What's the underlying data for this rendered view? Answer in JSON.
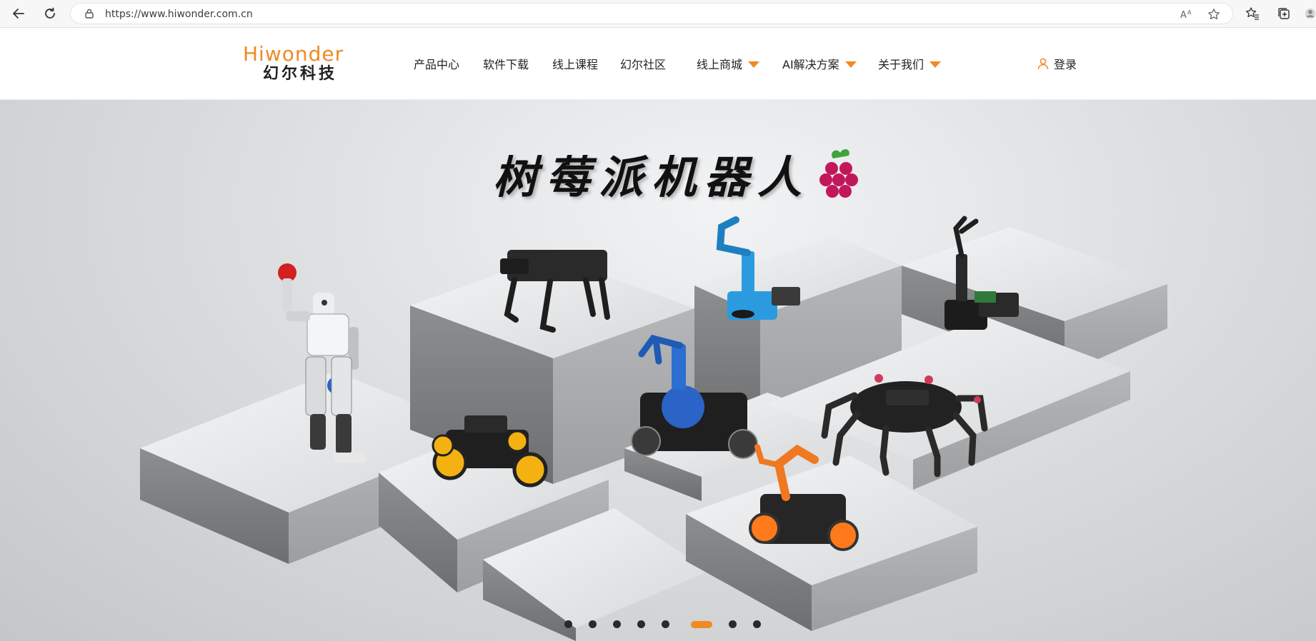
{
  "browser": {
    "url": "https://www.hiwonder.com.cn",
    "icons": [
      "back-icon",
      "reload-icon",
      "lock-icon",
      "read-aloud-icon",
      "favorite-star-icon",
      "favorites-icon",
      "collections-icon",
      "profile-icon"
    ]
  },
  "header": {
    "logo_en": "Hiwonder",
    "logo_cn": "幻尔科技",
    "nav": [
      {
        "label": "产品中心",
        "dropdown": false
      },
      {
        "label": "软件下载",
        "dropdown": false
      },
      {
        "label": "线上课程",
        "dropdown": false
      },
      {
        "label": "幻尔社区",
        "dropdown": false
      },
      {
        "label": "线上商城",
        "dropdown": true
      },
      {
        "label": "AI解决方案",
        "dropdown": true
      },
      {
        "label": "关于我们",
        "dropdown": true
      }
    ],
    "login_label": "登录"
  },
  "hero": {
    "title": "树莓派机器人",
    "slide_count": 8,
    "active_slide": 6
  },
  "colors": {
    "accent": "#f08a24",
    "text": "#222222"
  }
}
